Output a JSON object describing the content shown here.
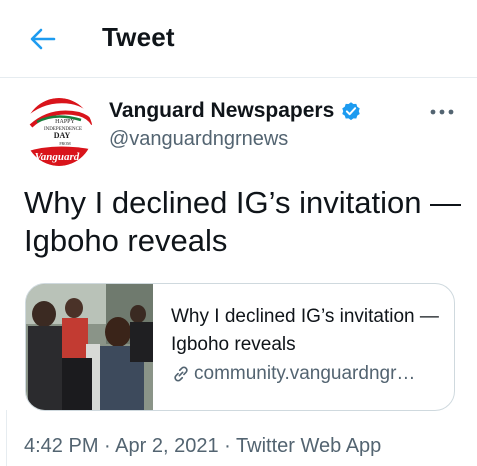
{
  "header": {
    "title": "Tweet",
    "back_icon": "arrow-left-icon"
  },
  "author": {
    "name": "Vanguard Newspapers",
    "handle": "@vanguardngrnews",
    "verified_icon": "verified-badge-icon",
    "avatar_text": [
      "HAPPY",
      "INDEPENDENCE",
      "DAY",
      "FROM",
      "Vanguard"
    ]
  },
  "more_icon": "more-dots-icon",
  "tweet": {
    "text": "Why I declined IG’s invitation — Igboho reveals"
  },
  "card": {
    "title": "Why I declined IG’s invitation — Igboho reveals",
    "link_text": "community.vanguardngr…",
    "link_icon": "link-icon"
  },
  "meta": {
    "time": "4:42 PM",
    "separator1": "·",
    "date": "Apr 2, 2021",
    "separator2": "·",
    "source": "Twitter Web App"
  },
  "colors": {
    "accent": "#1d9bf0",
    "text": "#0f1419",
    "secondary": "#536471",
    "border": "#cfd9de"
  }
}
